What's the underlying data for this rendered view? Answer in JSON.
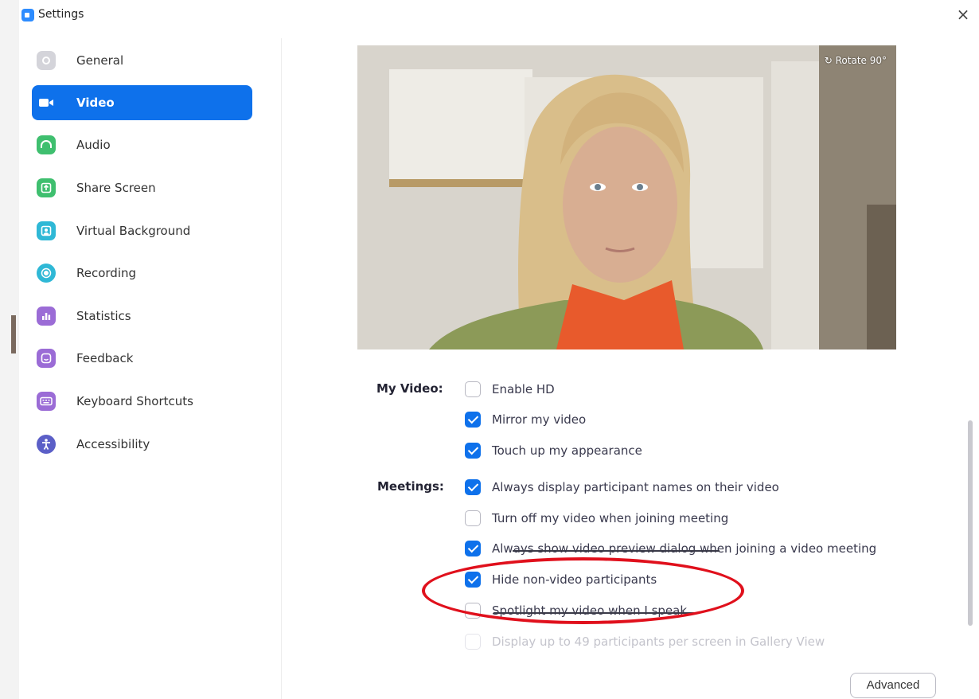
{
  "window": {
    "title": "Settings",
    "close_symbol": "×"
  },
  "sidebar": {
    "items": [
      {
        "label": "General",
        "icon": "gear-icon",
        "color": "#c9c9cf",
        "active": false
      },
      {
        "label": "Video",
        "icon": "video-camera-icon",
        "color": "#ffffff",
        "active": true
      },
      {
        "label": "Audio",
        "icon": "headphones-icon",
        "color": "#3fbf6f",
        "active": false
      },
      {
        "label": "Share Screen",
        "icon": "share-screen-icon",
        "color": "#3fbf6f",
        "active": false
      },
      {
        "label": "Virtual Background",
        "icon": "virtual-background-icon",
        "color": "#2fb8d6",
        "active": false
      },
      {
        "label": "Recording",
        "icon": "recording-icon",
        "color": "#2fb8d6",
        "active": false
      },
      {
        "label": "Statistics",
        "icon": "statistics-icon",
        "color": "#9b6cd6",
        "active": false
      },
      {
        "label": "Feedback",
        "icon": "feedback-icon",
        "color": "#9b6cd6",
        "active": false
      },
      {
        "label": "Keyboard Shortcuts",
        "icon": "keyboard-icon",
        "color": "#9b6cd6",
        "active": false
      },
      {
        "label": "Accessibility",
        "icon": "accessibility-icon",
        "color": "#5b5fc7",
        "active": false
      }
    ]
  },
  "preview": {
    "rotate_label": "Rotate 90°"
  },
  "my_video": {
    "label": "My Video:",
    "options": [
      {
        "label": "Enable HD",
        "checked": false
      },
      {
        "label": "Mirror my video",
        "checked": true
      },
      {
        "label": "Touch up my appearance",
        "checked": true
      }
    ]
  },
  "meetings": {
    "label": "Meetings:",
    "options": [
      {
        "label": "Always display participant names on their video",
        "checked": true
      },
      {
        "label": "Turn off my video when joining meeting",
        "checked": false
      },
      {
        "label": "Always show video preview dialog when joining a video meeting",
        "checked": true
      },
      {
        "label": "Hide non-video participants",
        "checked": true
      },
      {
        "label": "Spotlight my video when I speak",
        "checked": false
      },
      {
        "label": "Display up to 49 participants per screen in Gallery View",
        "checked": false,
        "disabled": true
      }
    ]
  },
  "advanced_button": "Advanced",
  "colors": {
    "accent": "#0e71eb",
    "highlight": "#e0101c"
  }
}
